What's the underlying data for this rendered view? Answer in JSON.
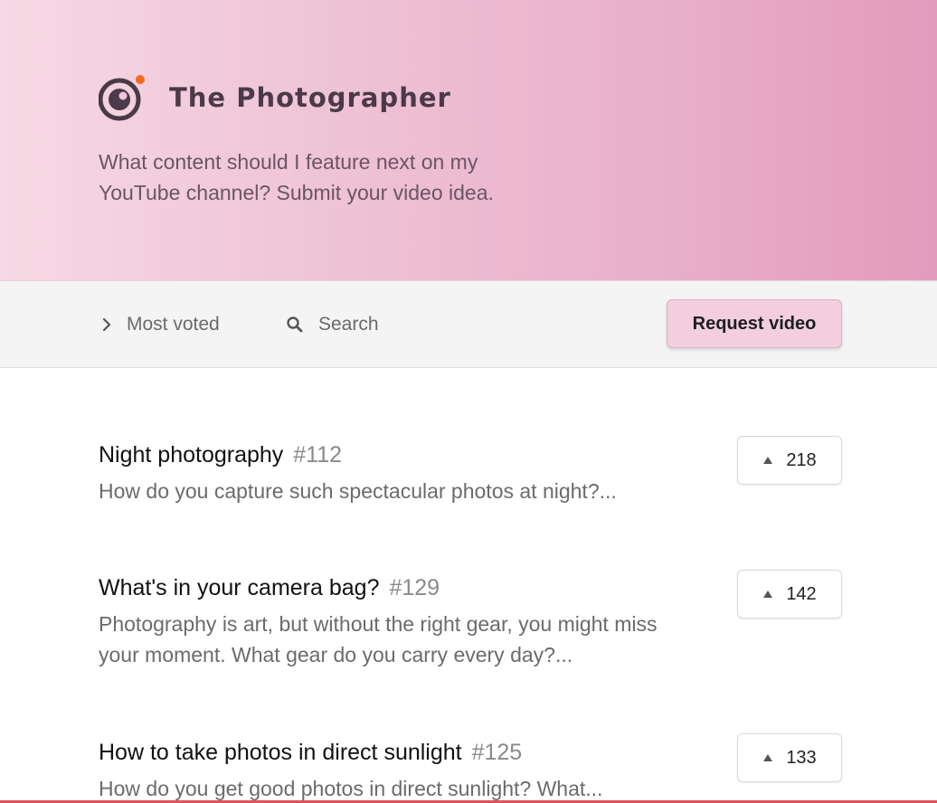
{
  "header": {
    "brand_name": "The Photographer",
    "tagline": "What content should I feature next on my YouTube channel? Submit your video idea.",
    "logo_icon": "camera-lens-icon",
    "colors": {
      "gradient_start": "#f6d9e4",
      "gradient_end": "#e29bbc",
      "logo_dark": "#4b3a47",
      "logo_dot": "#f26b1d"
    }
  },
  "toolbar": {
    "sort_label": "Most voted",
    "sort_icon": "chevron-right-icon",
    "search_label": "Search",
    "search_icon": "search-icon",
    "request_label": "Request video"
  },
  "items": [
    {
      "title": "Night photography",
      "id": "#112",
      "description": "How do you capture such spectacular photos at night?...",
      "votes": "218"
    },
    {
      "title": "What's in your camera bag?",
      "id": "#129",
      "description": "Photography is art, but without the right gear, you might miss your moment. What gear do you carry every day?...",
      "votes": "142"
    },
    {
      "title": "How to take photos in direct sunlight",
      "id": "#125",
      "description": "How do you get good photos in direct sunlight? What...",
      "votes": "133"
    }
  ]
}
